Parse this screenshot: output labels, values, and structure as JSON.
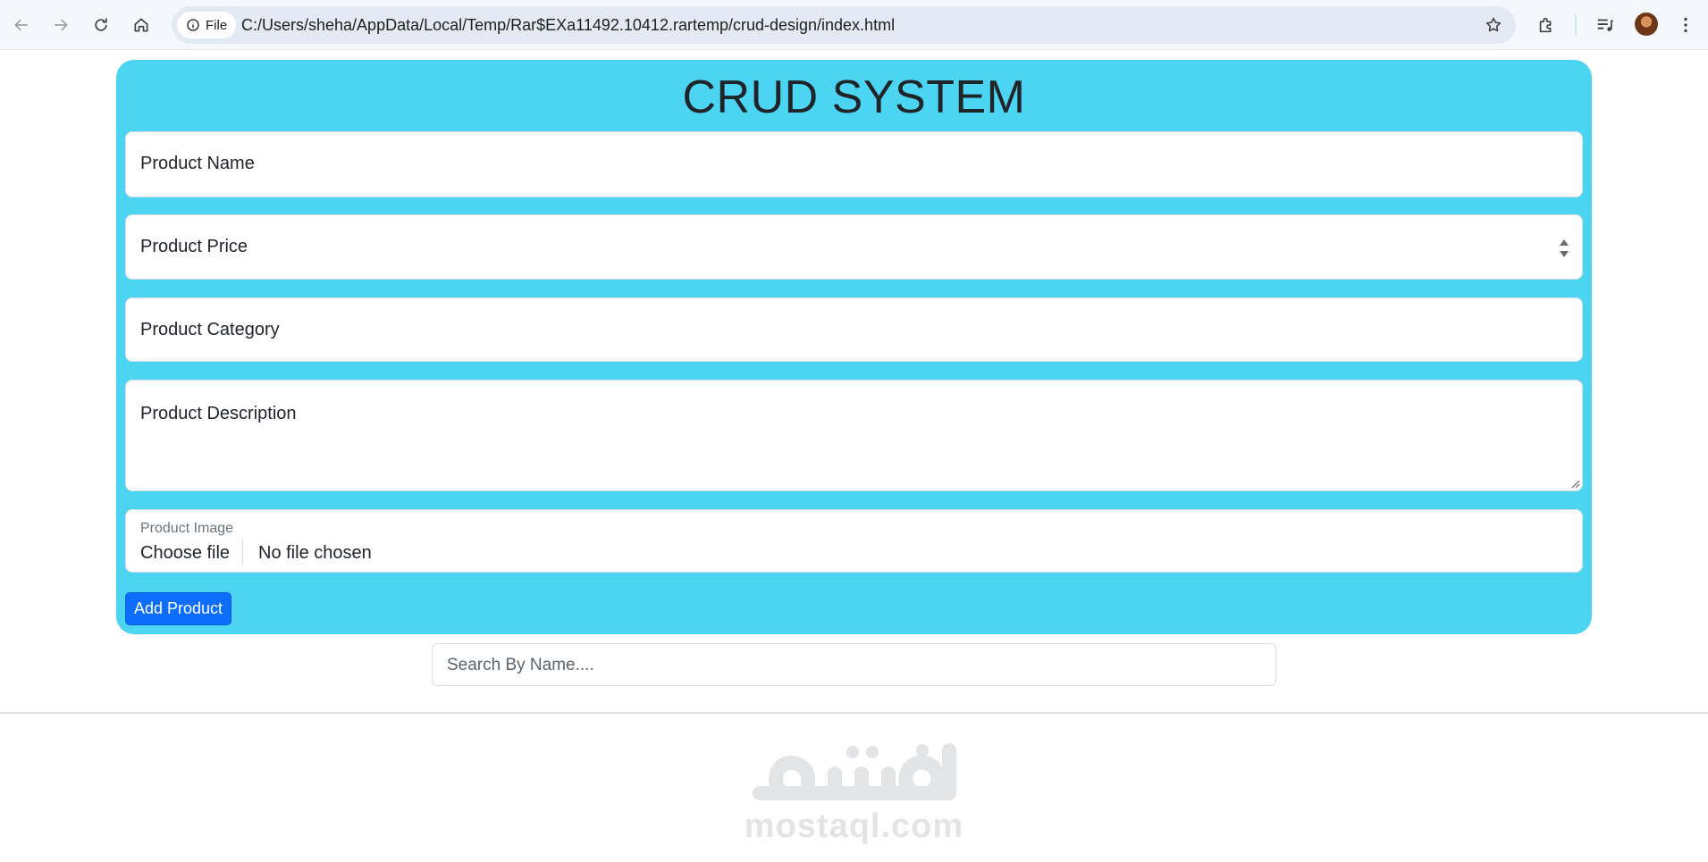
{
  "browser": {
    "site_chip": "File",
    "url": "C:/Users/sheha/AppData/Local/Temp/Rar$EXa11492.10412.rartemp/crud-design/index.html"
  },
  "page": {
    "title": "CRUD SYSTEM",
    "product_name_placeholder": "Product Name",
    "product_price_placeholder": "Product Price",
    "product_category_placeholder": "Product Category",
    "product_description_placeholder": "Product Description",
    "product_image_label": "Product Image",
    "choose_file_label": "Choose file",
    "no_file_text": "No file chosen",
    "add_button_label": "Add Product",
    "search_placeholder": "Search By Name...."
  },
  "watermark": {
    "text": "mostaql.com"
  },
  "colors": {
    "card_bg": "#4bd5f2",
    "button_primary": "#0d6efd"
  }
}
